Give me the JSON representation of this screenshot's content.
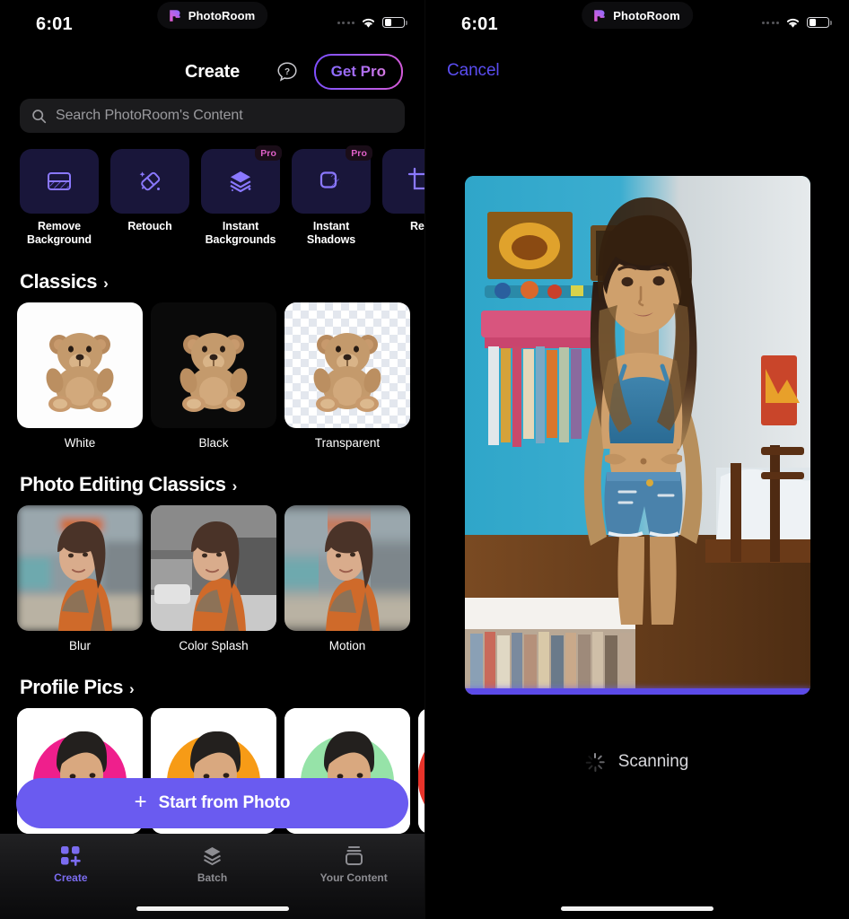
{
  "status_bar": {
    "time": "6:01",
    "island_app_name": "PhotoRoom",
    "wifi_icon": "wifi-icon",
    "battery_icon": "battery-icon",
    "cellular_dots_icon": "cellular-dots-icon"
  },
  "left_screen": {
    "nav": {
      "title": "Create",
      "help_icon": "question-mark-bubble-icon",
      "get_pro_label": "Get Pro"
    },
    "search": {
      "placeholder": "Search PhotoRoom's Content",
      "icon": "search-icon"
    },
    "tools": [
      {
        "label": "Remove\nBackground",
        "label_line1": "Remove",
        "label_line2": "Background",
        "icon": "remove-background-icon",
        "pro": false
      },
      {
        "label": "Retouch",
        "label_line1": "Retouch",
        "label_line2": "",
        "icon": "retouch-eraser-icon",
        "pro": false
      },
      {
        "label": "Instant Backgrounds",
        "label_line1": "Instant",
        "label_line2": "Backgrounds",
        "icon": "instant-backgrounds-layers-icon",
        "pro": true,
        "pro_label": "Pro"
      },
      {
        "label": "Instant Shadows",
        "label_line1": "Instant",
        "label_line2": "Shadows",
        "icon": "instant-shadows-icon",
        "pro": true,
        "pro_label": "Pro"
      },
      {
        "label": "Resize",
        "label_line1": "Resi",
        "label_line2": "",
        "icon": "resize-crop-icon",
        "pro": false
      }
    ],
    "sections": [
      {
        "title": "Classics",
        "chevron_icon": "chevron-right-icon",
        "items": [
          {
            "caption": "White",
            "style": "white"
          },
          {
            "caption": "Black",
            "style": "black"
          },
          {
            "caption": "Transparent",
            "style": "transparent"
          }
        ]
      },
      {
        "title": "Photo Editing Classics",
        "chevron_icon": "chevron-right-icon",
        "items": [
          {
            "caption": "Blur",
            "style": "blur"
          },
          {
            "caption": "Color Splash",
            "style": "splash"
          },
          {
            "caption": "Motion",
            "style": "motion"
          }
        ]
      },
      {
        "title": "Profile Pics",
        "chevron_icon": "chevron-right-icon",
        "items": [
          {
            "caption": "",
            "style": "pink"
          },
          {
            "caption": "",
            "style": "orange"
          },
          {
            "caption": "",
            "style": "green"
          },
          {
            "caption": "",
            "style": "rainbow"
          }
        ]
      }
    ],
    "primary_action": {
      "label": "Start from Photo",
      "plus_icon": "plus-icon",
      "color": "#6a5bf0"
    },
    "tab_bar": [
      {
        "label": "Create",
        "icon": "grid-plus-icon",
        "active": true
      },
      {
        "label": "Batch",
        "icon": "layers-icon",
        "active": false
      },
      {
        "label": "Your Content",
        "icon": "content-stack-icon",
        "active": false
      }
    ]
  },
  "right_screen": {
    "cancel_label": "Cancel",
    "cancel_color": "#5a4df0",
    "photo_alt": "girl-in-bedroom-photo",
    "progress": {
      "percent": 100,
      "color": "#5b4ae8"
    },
    "status": {
      "label": "Scanning",
      "spinner_icon": "loading-spinner-icon"
    }
  }
}
